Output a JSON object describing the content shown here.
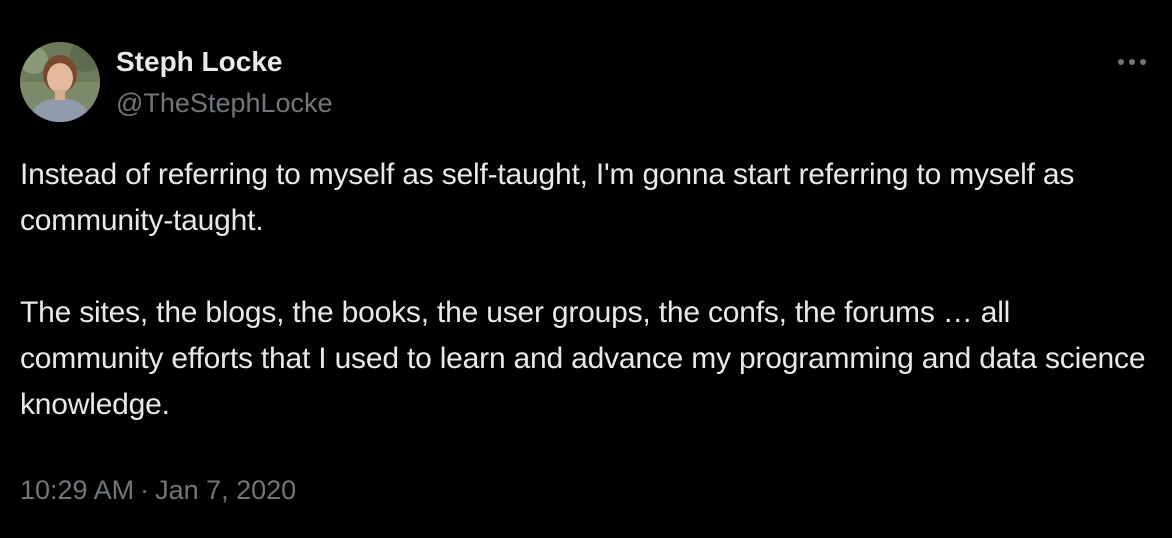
{
  "tweet": {
    "author": {
      "display_name": "Steph Locke",
      "handle": "@TheStephLocke",
      "avatar_icon": "profile-photo"
    },
    "more_icon": "more-horizontal-icon",
    "text_paragraphs": [
      "Instead of referring to myself as self-taught, I'm gonna start referring to myself as community-taught.",
      "The sites, the blogs, the books, the user groups, the confs, the forums … all community efforts that I used to learn and advance my programming and data science knowledge."
    ],
    "time": "10:29 AM",
    "separator": "·",
    "date": "Jan 7, 2020"
  },
  "colors": {
    "background": "#000000",
    "primary_text": "#e7e9ea",
    "secondary_text": "#71767b"
  }
}
